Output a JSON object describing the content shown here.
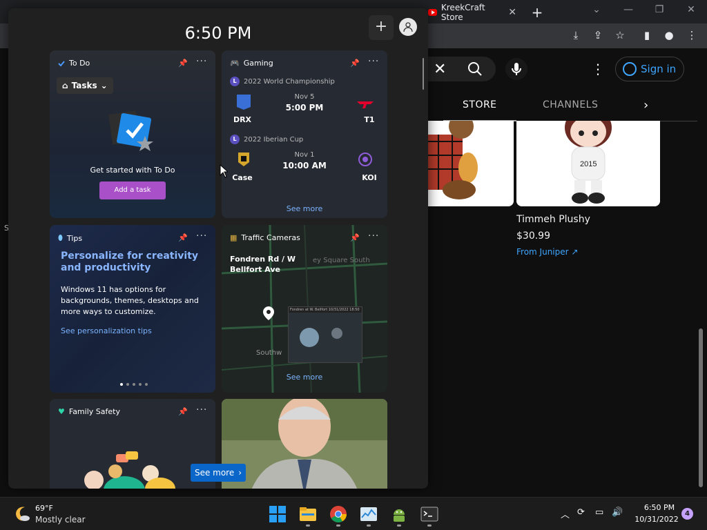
{
  "browser": {
    "tab_title": "KreekCraft Store",
    "tab_close": "✕",
    "new_tab": "+",
    "win_min": "—",
    "win_restore": "❐",
    "win_close": "✕"
  },
  "youtube": {
    "signin_label": "Sign in",
    "tabs": [
      "STORE",
      "CHANNELS"
    ],
    "product_name": "Timmeh Plushy",
    "product_price": "$30.99",
    "product_from": "From Juniper",
    "edge_letter": "S"
  },
  "widgets": {
    "time": "6:50 PM",
    "add_label": "+",
    "todo": {
      "title": "To Do",
      "tasks_label": "Tasks",
      "message": "Get started with To Do",
      "add_label": "Add a task"
    },
    "gaming": {
      "title": "Gaming",
      "see_more": "See more",
      "matches": [
        {
          "event": "2022 World Championship",
          "date": "Nov 5",
          "time": "5:00 PM",
          "team1": "DRX",
          "team2": "T1"
        },
        {
          "event": "2022 Iberian Cup",
          "date": "Nov 1",
          "time": "10:00 AM",
          "team1": "Case",
          "team2": "KOI"
        }
      ]
    },
    "tips": {
      "title": "Tips",
      "headline": "Personalize for creativity and productivity",
      "body": "Windows 11 has options for backgrounds, themes, desktops and more ways to customize.",
      "link": "See personalization tips"
    },
    "traffic": {
      "title": "Traffic Cameras",
      "road": "Fondren Rd / W Bellfort Ave",
      "map_label1": "ey Square South",
      "map_label2": "Southw",
      "cam_caption": "Fondren at W. Bellfort 10/31/2022 18:50",
      "see_more": "See more"
    },
    "family": {
      "title": "Family Safety",
      "see_more": "See more"
    }
  },
  "taskbar": {
    "temp": "69°F",
    "condition": "Mostly clear",
    "clock_time": "6:50 PM",
    "clock_date": "10/31/2022",
    "notifications": "4"
  }
}
